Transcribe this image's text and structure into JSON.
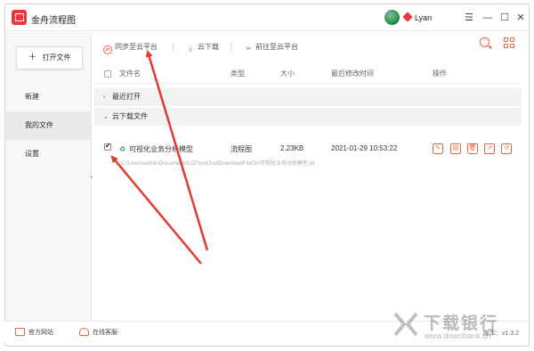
{
  "app": {
    "title": "金舟流程图"
  },
  "user": {
    "name": "Lyan"
  },
  "window_controls": {
    "menu": "☰",
    "minimize": "—",
    "maximize": "☐",
    "close": "✕"
  },
  "sidebar": {
    "open_button": "打开文件",
    "items": [
      {
        "label": "新建",
        "active": false
      },
      {
        "label": "我的文件",
        "active": true
      },
      {
        "label": "设置",
        "active": false
      }
    ]
  },
  "toolbar": {
    "sync": "同步至云平台",
    "download": "云下载",
    "goto": "前往至云平台"
  },
  "table": {
    "headers": {
      "name": "文件名",
      "type": "类型",
      "size": "大小",
      "modified": "最后修改时间",
      "ops": "操作"
    },
    "groups": [
      {
        "label": "最近打开",
        "expanded": false
      },
      {
        "label": "云下载文件",
        "expanded": true
      }
    ],
    "rows": [
      {
        "checked": true,
        "name": "可视化业务分析模型",
        "type": "流程图",
        "size": "2.23KB",
        "modified": "2021-01-29 10:53:22",
        "path": "C:\\Users\\admin\\Documents\\UZFlowChartDownloadFileDir\\可视化业务分析模型.jst"
      }
    ]
  },
  "statusbar": {
    "website": "官方网站",
    "support": "在线客服",
    "version": "版本：v1.3.2"
  },
  "watermark": {
    "title": "下载银行",
    "url": "www.downbank.cn"
  },
  "colors": {
    "accent": "#e8683d",
    "brand": "#e8383d",
    "annotation_arrow": "#e23a2e"
  }
}
